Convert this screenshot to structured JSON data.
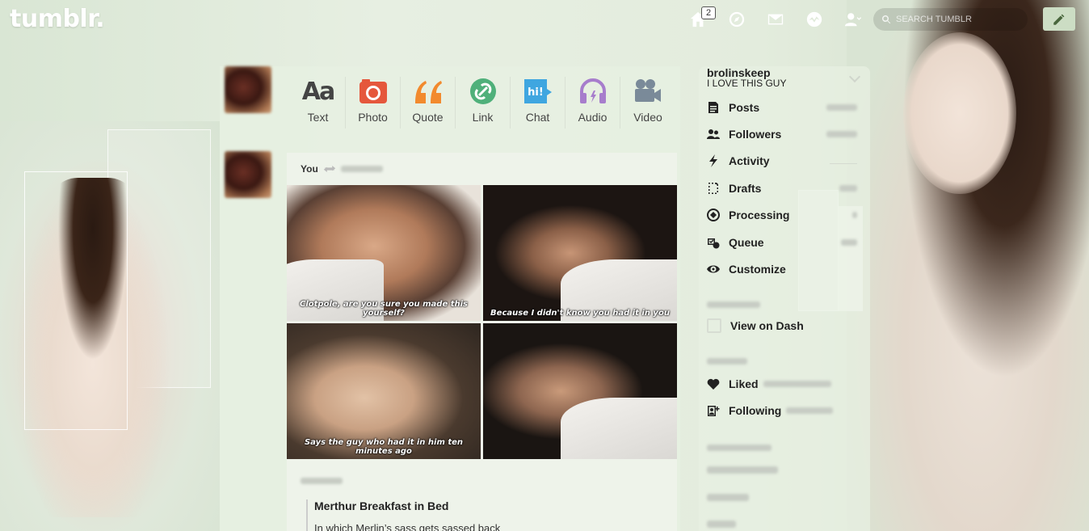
{
  "header": {
    "logo": "tumblr.",
    "home_badge": "2",
    "search_placeholder": "SEARCH TUMBLR"
  },
  "post_types": [
    {
      "label": "Text",
      "icon": "text-icon",
      "color": "#444444"
    },
    {
      "label": "Photo",
      "icon": "camera-icon",
      "color": "#e5573c"
    },
    {
      "label": "Quote",
      "icon": "quote-icon",
      "color": "#f28a2e"
    },
    {
      "label": "Link",
      "icon": "link-icon",
      "color": "#4fb07a"
    },
    {
      "label": "Chat",
      "icon": "chat-icon",
      "color": "#3fa6e0"
    },
    {
      "label": "Audio",
      "icon": "headphones-icon",
      "color": "#a77dcc"
    },
    {
      "label": "Video",
      "icon": "video-camera-icon",
      "color": "#7a8a99"
    }
  ],
  "post": {
    "author": "You",
    "captions": [
      "Clotpole, are you sure you made this yourself?",
      "Because I didn't know you had it in you",
      "Says the guy who had it in him ten minutes ago",
      ""
    ],
    "title": "Merthur Breakfast in Bed",
    "text": "In which Merlin’s sass gets sassed back"
  },
  "sidebar": {
    "blog_name": "brolinskeep",
    "blog_title": "I LOVE THIS GUY",
    "items": [
      {
        "label": "Posts",
        "icon": "document-icon"
      },
      {
        "label": "Followers",
        "icon": "followers-icon"
      },
      {
        "label": "Activity",
        "icon": "lightning-icon"
      },
      {
        "label": "Drafts",
        "icon": "drafts-icon"
      },
      {
        "label": "Processing",
        "icon": "processing-icon"
      },
      {
        "label": "Queue",
        "icon": "queue-icon"
      },
      {
        "label": "Customize",
        "icon": "eye-icon"
      }
    ],
    "view_on_dash": "View on Dash",
    "liked": "Liked",
    "following": "Following"
  }
}
